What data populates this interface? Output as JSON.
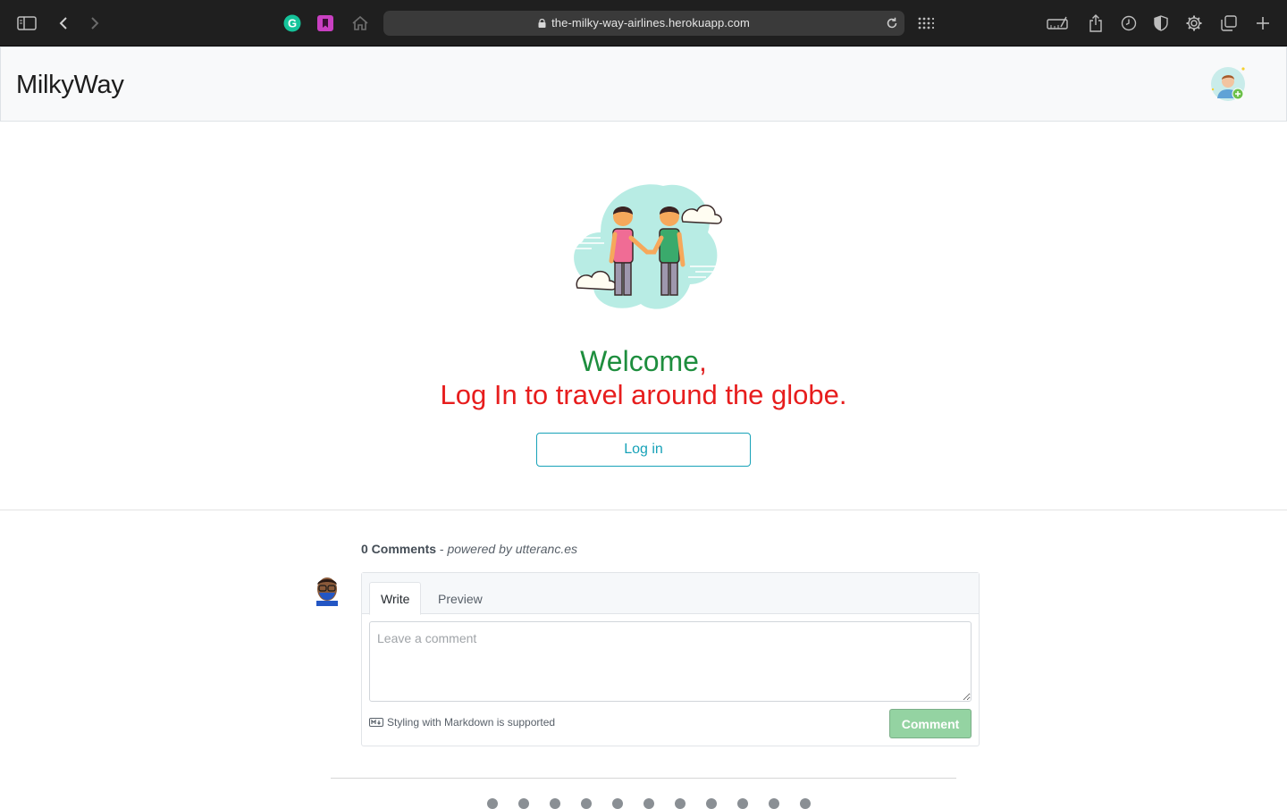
{
  "browser": {
    "url": "the-milky-way-airlines.herokuapp.com",
    "icons": [
      "sidebar-icon",
      "back-icon",
      "forward-icon",
      "grammarly-icon",
      "bookmark-extension-icon",
      "home-icon",
      "reload-icon",
      "grid-icon",
      "ruler-icon",
      "share-icon",
      "history-icon",
      "shield-icon",
      "gear-icon",
      "tabs-icon",
      "plus-icon"
    ]
  },
  "nav": {
    "brand": "MilkyWay",
    "avatar_icon": "user-add-icon"
  },
  "hero": {
    "welcome": "Welcome",
    "comma": ",",
    "tagline": "Log In to travel around the globe.",
    "login_label": "Log in",
    "colors": {
      "welcome": "#1e8e3e",
      "tagline": "#e71d1d",
      "button": "#17a2b8"
    }
  },
  "comments": {
    "count_label": "0 Comments",
    "separator": " - ",
    "powered_by": "powered by utteranc.es",
    "tabs": [
      {
        "label": "Write",
        "active": true
      },
      {
        "label": "Preview",
        "active": false
      }
    ],
    "placeholder": "Leave a comment",
    "markdown_hint": "Styling with Markdown is supported",
    "submit_label": "Comment"
  }
}
